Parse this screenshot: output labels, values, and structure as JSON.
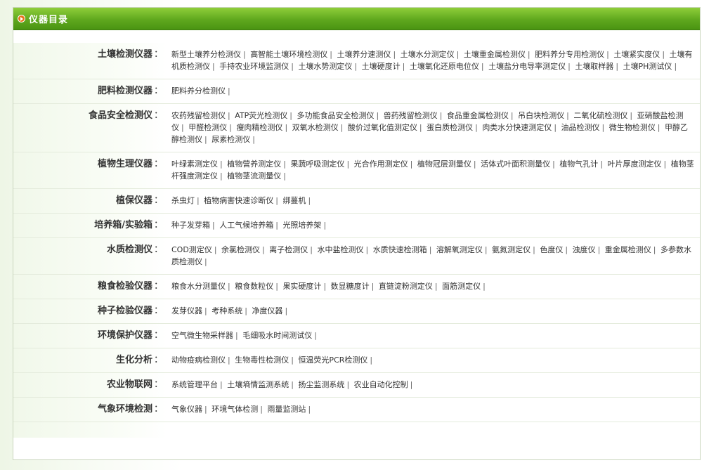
{
  "header": {
    "title": "仪器目录"
  },
  "categories": [
    {
      "name": "土壤检测仪器",
      "items": [
        "新型土壤养分检测仪",
        "高智能土壤环境检测仪",
        "土壤养分速测仪",
        "土壤水分测定仪",
        "土壤重金属检测仪",
        "肥料养分专用检测仪",
        "土壤紧实度仪",
        "土壤有机质检测仪",
        "手持农业环境监测仪",
        "土壤水势测定仪",
        "土壤硬度计",
        "土壤氧化还原电位仪",
        "土壤盐分电导率测定仪",
        "土壤取样器",
        "土壤PH测试仪"
      ]
    },
    {
      "name": "肥料检测仪器",
      "items": [
        "肥料养分检测仪"
      ]
    },
    {
      "name": "食品安全检测仪",
      "items": [
        "农药残留检测仪",
        "ATP荧光检测仪",
        "多功能食品安全检测仪",
        "兽药残留检测仪",
        "食品重金属检测仪",
        "吊白块检测仪",
        "二氧化硫检测仪",
        "亚硝酸盐检测仪",
        "甲醛检测仪",
        "瘦肉精检测仪",
        "双氧水检测仪",
        "酸价过氧化值测定仪",
        "蛋白质检测仪",
        "肉类水分快速测定仪",
        "油品检测仪",
        "微生物检测仪",
        "甲醇乙醇检测仪",
        "尿素检测仪"
      ]
    },
    {
      "name": "植物生理仪器",
      "items": [
        "叶绿素测定仪",
        "植物营养测定仪",
        "果蔬呼吸测定仪",
        "光合作用测定仪",
        "植物冠层测量仪",
        "活体式叶面积测量仪",
        "植物气孔计",
        "叶片厚度测定仪",
        "植物茎杆强度测定仪",
        "植物茎流测量仪"
      ]
    },
    {
      "name": "植保仪器",
      "items": [
        "杀虫灯",
        "植物病害快速诊断仪",
        "绑蔓机"
      ]
    },
    {
      "name": "培养箱/实验箱",
      "items": [
        "种子发芽箱",
        "人工气候培养箱",
        "光照培养架"
      ]
    },
    {
      "name": "水质检测仪",
      "items": [
        "COD测定仪",
        "余氯检测仪",
        "离子检测仪",
        "水中盐检测仪",
        "水质快速检测箱",
        "溶解氧测定仪",
        "氨氮测定仪",
        "色度仪",
        "浊度仪",
        "重金属检测仪",
        "多参数水质检测仪"
      ]
    },
    {
      "name": "粮食检验仪器",
      "items": [
        "粮食水分测量仪",
        "粮食数粒仪",
        "果实硬度计",
        "数显糖度计",
        "直链淀粉测定仪",
        "面筋测定仪"
      ]
    },
    {
      "name": "种子检验仪器",
      "items": [
        "发芽仪器",
        "考种系统",
        "净度仪器"
      ]
    },
    {
      "name": "环境保护仪器",
      "items": [
        "空气微生物采样器",
        "毛细吸水时间测试仪"
      ]
    },
    {
      "name": "生化分析",
      "items": [
        "动物疫病检测仪",
        "生物毒性检测仪",
        "恒温荧光PCR检测仪"
      ]
    },
    {
      "name": "农业物联网",
      "items": [
        "系统管理平台",
        "土壤墒情监测系统",
        "扬尘监测系统",
        "农业自动化控制"
      ]
    },
    {
      "name": "气象环境检测",
      "items": [
        "气象仪器",
        "环境气体检测",
        "雨量监测站"
      ]
    }
  ],
  "colon": "：",
  "separator": "|"
}
